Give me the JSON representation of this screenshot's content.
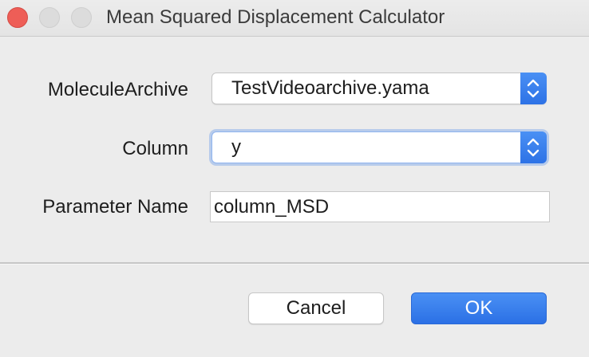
{
  "window": {
    "title": "Mean Squared Displacement Calculator"
  },
  "form": {
    "archive_label": "MoleculeArchive",
    "archive_value": "TestVideoarchive.yama",
    "column_label": "Column",
    "column_value": "y",
    "parameter_label": "Parameter Name",
    "parameter_value": "column_MSD"
  },
  "buttons": {
    "cancel_label": "Cancel",
    "ok_label": "OK"
  },
  "colors": {
    "accent": "#2f76ea",
    "close_button": "#ee5e57",
    "background": "#ececec"
  },
  "icons": {
    "select_arrows": "up-down-chevron-icon"
  }
}
